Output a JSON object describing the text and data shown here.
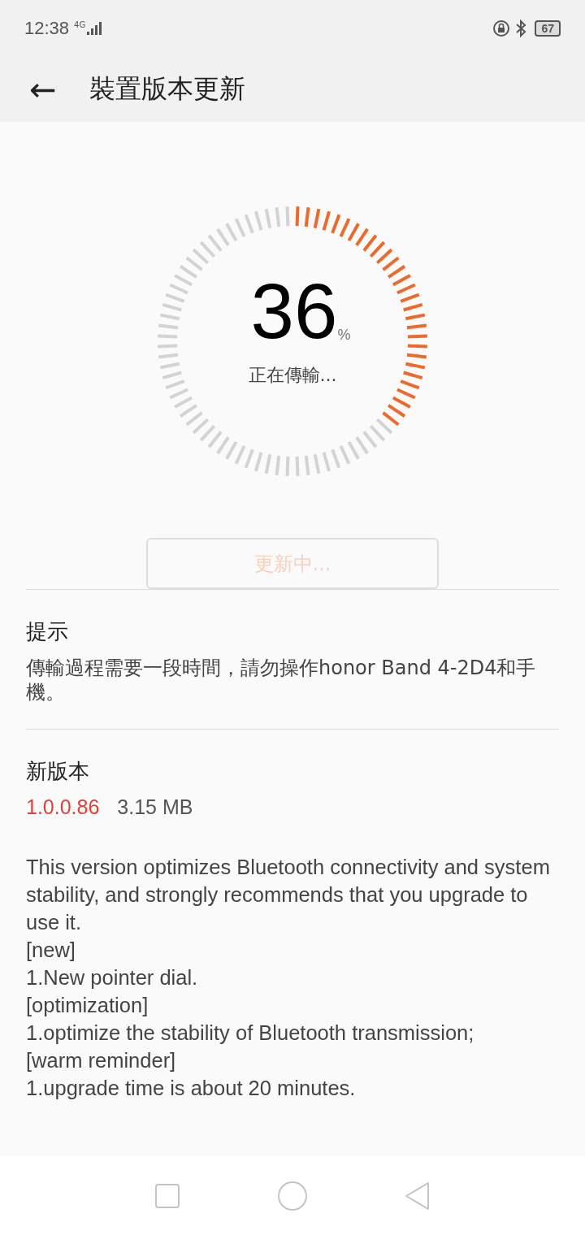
{
  "status_bar": {
    "time": "12:38",
    "network": "4G",
    "battery": "67"
  },
  "header": {
    "back": "←",
    "title": "裝置版本更新"
  },
  "progress": {
    "value": "36",
    "unit": "%",
    "caption": "正在傳輸..."
  },
  "update_button": {
    "label": "更新中...",
    "disabled": true
  },
  "tip": {
    "title": "提示",
    "text": "傳輸過程需要一段時間，請勿操作honor Band 4-2D4和手機。"
  },
  "new_version": {
    "title": "新版本",
    "version": "1.0.0.86",
    "size": "3.15 MB",
    "notes": [
      "This version optimizes Bluetooth connectivity and system stability, and strongly recommends that you upgrade to use it.",
      "[new]",
      "1.New pointer dial.",
      "[optimization]",
      "1.optimize the stability of Bluetooth transmission;",
      "[warm reminder]",
      "1.upgrade time is about 20 minutes."
    ]
  }
}
